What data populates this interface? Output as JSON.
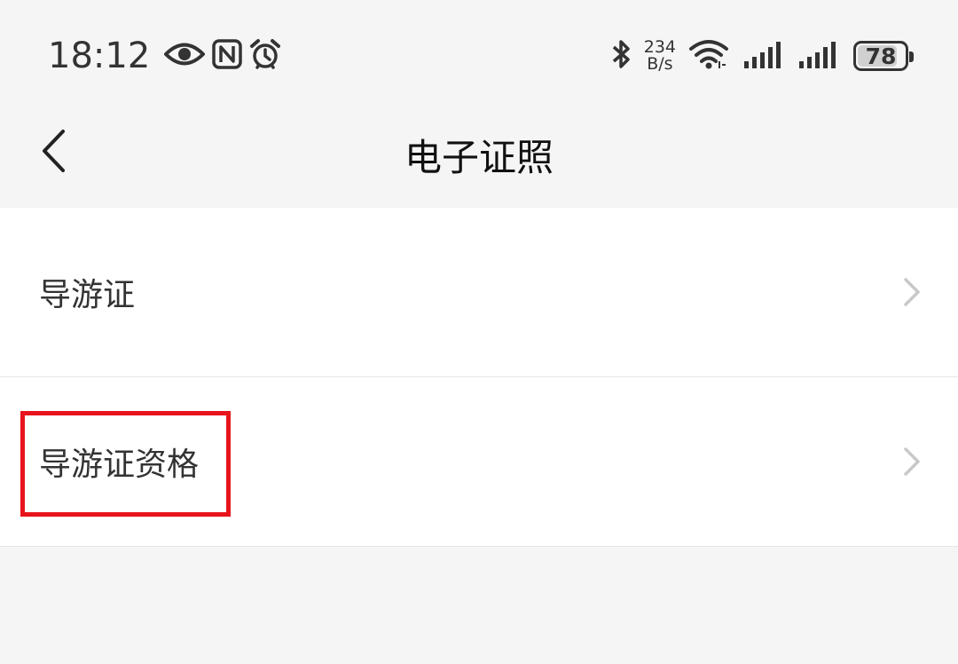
{
  "status_bar": {
    "time": "18:12",
    "net_speed_value": "234",
    "net_speed_unit": "B/s",
    "battery_level": "78",
    "icons": [
      "eye-icon",
      "nfc-icon",
      "alarm-icon",
      "bluetooth-icon",
      "wifi-icon",
      "signal-icon",
      "signal-icon",
      "battery-icon"
    ]
  },
  "header": {
    "title": "电子证照",
    "back_icon": "chevron-left-icon"
  },
  "list": {
    "items": [
      {
        "label": "导游证",
        "icon": "chevron-right-icon"
      },
      {
        "label": "导游证资格",
        "icon": "chevron-right-icon",
        "highlighted": true
      }
    ]
  },
  "colors": {
    "background": "#f5f5f5",
    "card": "#ffffff",
    "highlight": "#e8141b",
    "text": "#333333"
  }
}
